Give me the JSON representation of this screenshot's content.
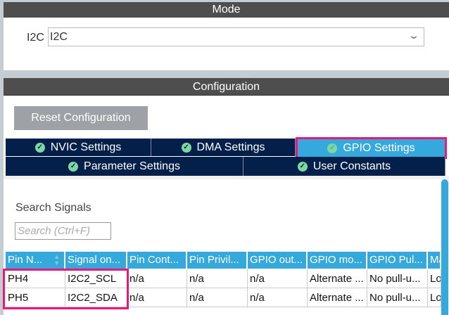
{
  "mode": {
    "title": "Mode",
    "field_label": "I2C",
    "select_value": "I2C"
  },
  "config": {
    "title": "Configuration",
    "reset_label": "Reset Configuration",
    "tabs": [
      {
        "label": "NVIC Settings"
      },
      {
        "label": "DMA Settings"
      },
      {
        "label": "GPIO Settings"
      },
      {
        "label": "Parameter Settings"
      },
      {
        "label": "User Constants"
      }
    ],
    "search_label": "Search Signals",
    "search_placeholder": "Search (Ctrl+F)"
  },
  "table": {
    "headers": [
      "Pin N...",
      "Signal on...",
      "Pin Cont...",
      "Pin Privil...",
      "GPIO out...",
      "GPIO mo...",
      "GPIO Pul...",
      "Ma"
    ],
    "rows": [
      [
        "PH4",
        "I2C2_SCL",
        "n/a",
        "n/a",
        "n/a",
        "Alternate ...",
        "No pull-u...",
        "Lo"
      ],
      [
        "PH5",
        "I2C2_SDA",
        "n/a",
        "n/a",
        "n/a",
        "Alternate ...",
        "No pull-u...",
        "Lo"
      ]
    ]
  },
  "colors": {
    "accent": "#36a9dc",
    "tab_bg": "#04204a",
    "highlight": "#e8197a"
  }
}
